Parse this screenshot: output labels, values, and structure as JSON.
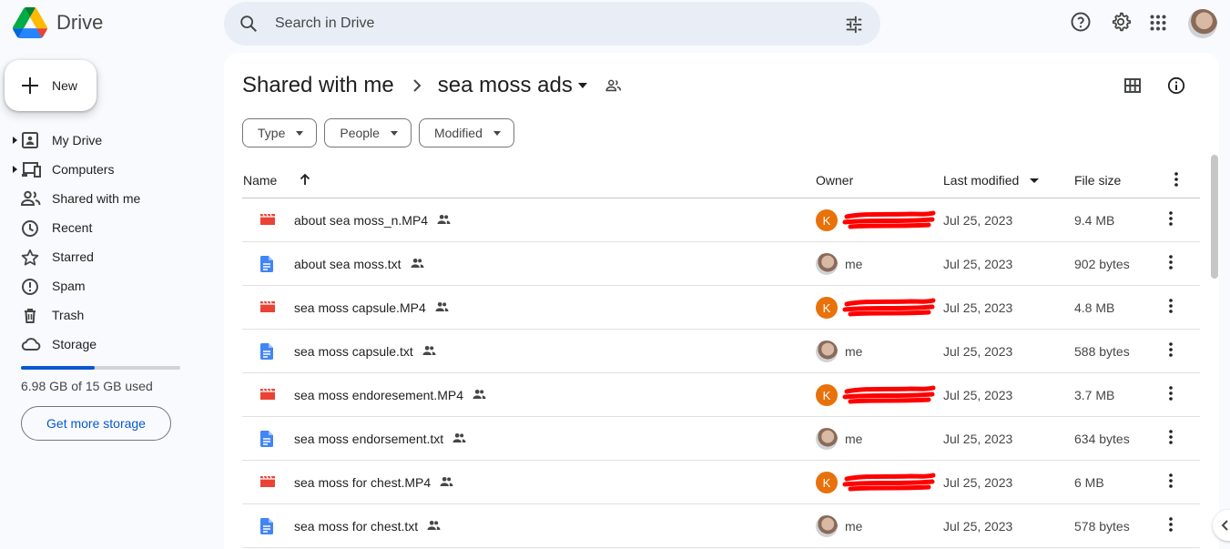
{
  "app": {
    "name": "Drive"
  },
  "search": {
    "placeholder": "Search in Drive"
  },
  "sidebar": {
    "new_label": "New",
    "items": [
      {
        "label": "My Drive",
        "icon": "my-drive-icon",
        "expandable": true
      },
      {
        "label": "Computers",
        "icon": "computers-icon",
        "expandable": true
      },
      {
        "label": "Shared with me",
        "icon": "shared-icon",
        "expandable": false
      },
      {
        "label": "Recent",
        "icon": "clock-icon",
        "expandable": false
      },
      {
        "label": "Starred",
        "icon": "star-icon",
        "expandable": false
      },
      {
        "label": "Spam",
        "icon": "spam-icon",
        "expandable": false
      },
      {
        "label": "Trash",
        "icon": "trash-icon",
        "expandable": false
      },
      {
        "label": "Storage",
        "icon": "cloud-icon",
        "expandable": false
      }
    ],
    "storage": {
      "used_text": "6.98 GB of 15 GB used",
      "used_fraction": 0.465,
      "button_label": "Get more storage"
    }
  },
  "breadcrumb": {
    "parent": "Shared with me",
    "current": "sea moss ads"
  },
  "filters": [
    "Type",
    "People",
    "Modified"
  ],
  "table": {
    "headers": {
      "name": "Name",
      "owner": "Owner",
      "modified": "Last modified",
      "size": "File size"
    },
    "rows": [
      {
        "name": "about sea moss_n.MP4",
        "type": "video",
        "owner_initial": "K",
        "owner": "",
        "modified": "Jul 25, 2023",
        "size": "9.4 MB"
      },
      {
        "name": "about sea moss.txt",
        "type": "doc",
        "owner_initial": "",
        "owner": "me",
        "modified": "Jul 25, 2023",
        "size": "902 bytes"
      },
      {
        "name": "sea moss capsule.MP4",
        "type": "video",
        "owner_initial": "K",
        "owner": "",
        "modified": "Jul 25, 2023",
        "size": "4.8 MB"
      },
      {
        "name": "sea moss capsule.txt",
        "type": "doc",
        "owner_initial": "",
        "owner": "me",
        "modified": "Jul 25, 2023",
        "size": "588 bytes"
      },
      {
        "name": "sea moss endoresement.MP4",
        "type": "video",
        "owner_initial": "K",
        "owner": "",
        "modified": "Jul 25, 2023",
        "size": "3.7 MB"
      },
      {
        "name": "sea moss endorsement.txt",
        "type": "doc",
        "owner_initial": "",
        "owner": "me",
        "modified": "Jul 25, 2023",
        "size": "634 bytes"
      },
      {
        "name": "sea moss for chest.MP4",
        "type": "video",
        "owner_initial": "K",
        "owner": "",
        "modified": "Jul 25, 2023",
        "size": "6 MB"
      },
      {
        "name": "sea moss for chest.txt",
        "type": "doc",
        "owner_initial": "",
        "owner": "me",
        "modified": "Jul 25, 2023",
        "size": "578 bytes"
      }
    ]
  },
  "colors": {
    "accent": "#0b57d0",
    "video": "#ea4335",
    "doc": "#4285f4",
    "owner_avatar": "#e8710a",
    "redaction": "#ff0000"
  }
}
